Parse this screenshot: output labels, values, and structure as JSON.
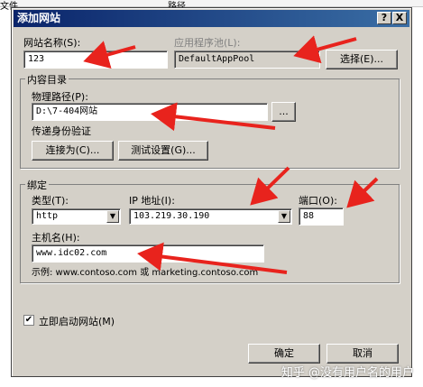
{
  "background": {
    "left_text": "文件",
    "right_text": "路径"
  },
  "dialog": {
    "title": "添加网站",
    "help_label": "?",
    "close_label": "X"
  },
  "site": {
    "name_label": "网站名称(S):",
    "name_value": "123",
    "pool_label": "应用程序池(L):",
    "pool_value": "DefaultAppPool",
    "select_button": "选择(E)..."
  },
  "content": {
    "group_title": "内容目录",
    "path_label": "物理路径(P):",
    "path_value": "D:\\7-404网站",
    "browse_button": "...",
    "passthrough_label": "传递身份验证",
    "connect_as_button": "连接为(C)...",
    "test_settings_button": "测试设置(G)..."
  },
  "binding": {
    "group_title": "绑定",
    "type_label": "类型(T):",
    "type_value": "http",
    "ip_label": "IP 地址(I):",
    "ip_value": "103.219.30.190",
    "port_label": "端口(O):",
    "port_value": "88",
    "host_label": "主机名(H):",
    "host_value": "www.idc02.com",
    "example_text": "示例: www.contoso.com 或 marketing.contoso.com"
  },
  "start_now": {
    "label": "立即启动网站(M)",
    "checked": true,
    "check_glyph": "✔"
  },
  "footer": {
    "ok_button": "确定",
    "cancel_button": "取消"
  },
  "watermark": "知乎 @没有用户名的用户",
  "colors": {
    "title_bar": "#0a246a",
    "dialog_face": "#d4d0c8",
    "arrow": "#e8231d"
  },
  "icons": [
    "help-icon",
    "close-icon",
    "dropdown-arrow-icon",
    "checkmark-icon"
  ]
}
